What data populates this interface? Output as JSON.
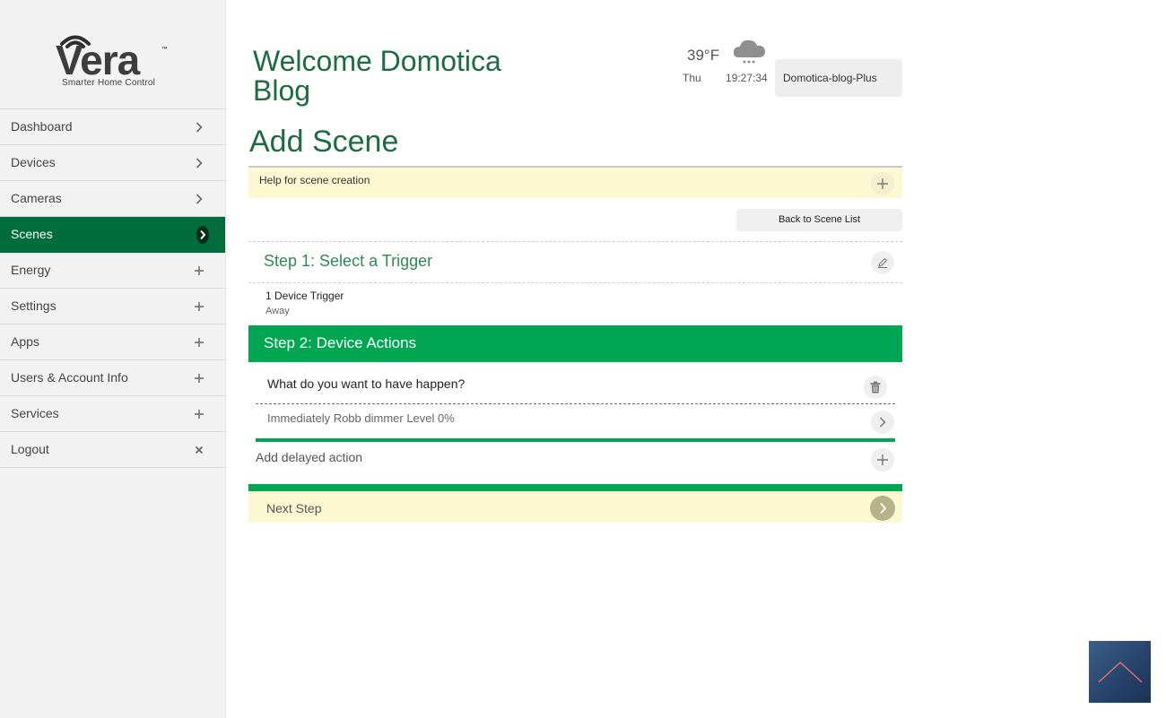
{
  "logo": {
    "word": "Vera",
    "tm": "™",
    "tagline": "Smarter Home Control"
  },
  "sidebar": {
    "items": [
      {
        "label": "Dashboard",
        "icon": "chevron-right-icon"
      },
      {
        "label": "Devices",
        "icon": "chevron-right-icon"
      },
      {
        "label": "Cameras",
        "icon": "chevron-right-icon"
      },
      {
        "label": "Scenes",
        "icon": "chevron-right-icon",
        "active": true
      },
      {
        "label": "Energy",
        "icon": "plus-icon"
      },
      {
        "label": "Settings",
        "icon": "plus-icon"
      },
      {
        "label": "Apps",
        "icon": "plus-icon"
      },
      {
        "label": "Users & Account Info",
        "icon": "plus-icon"
      },
      {
        "label": "Services",
        "icon": "plus-icon"
      },
      {
        "label": "Logout",
        "icon": "close-icon"
      }
    ]
  },
  "header": {
    "welcome": "Welcome Domotica Blog",
    "weather": {
      "temperature": "39°F",
      "day": "Thu",
      "time": "19:27:34",
      "icon": "snow-cloud-icon"
    },
    "user": "Domotica-blog-Plus"
  },
  "main": {
    "title": "Add Scene",
    "help_label": "Help for scene creation",
    "back_button": "Back to Scene List",
    "step1": {
      "title": "Step 1: Select a Trigger",
      "trigger_name": "1 Device Trigger",
      "trigger_mode": "Away"
    },
    "step2": {
      "title": "Step 2: Device Actions",
      "question": "What do you want to have happen?",
      "action": "Immediately Robb dimmer Level 0%",
      "add_delayed": "Add delayed action"
    },
    "next_step": "Next Step"
  },
  "colors": {
    "brand_dark_green": "#006d3c",
    "brand_green": "#00a651",
    "title_green": "#1d6b45",
    "help_bg": "#fbf8d2",
    "sidebar_bg": "#f2f2f2"
  }
}
